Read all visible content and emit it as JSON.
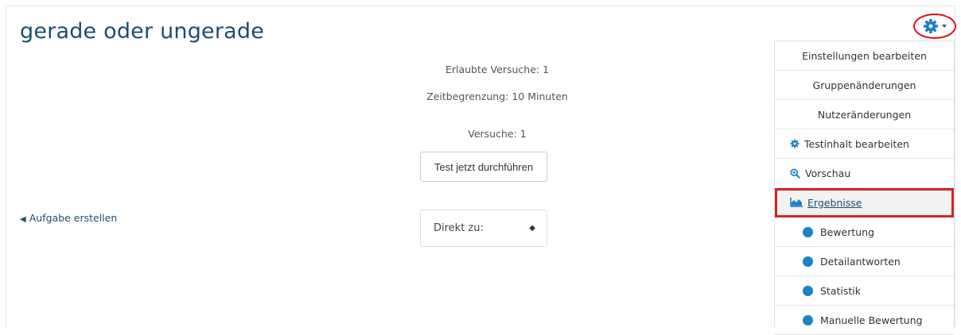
{
  "page": {
    "title": "gerade oder ungerade",
    "attempts_allowed": "Erlaubte Versuche: 1",
    "time_limit": "Zeitbegrenzung: 10 Minuten",
    "attempts": "Versuche: 1",
    "attempt_button": "Test jetzt durchführen",
    "jump_label": "Direkt zu:",
    "prev_link": "Aufgabe erstellen"
  },
  "menu": {
    "items": [
      {
        "label": "Einstellungen bearbeiten"
      },
      {
        "label": "Gruppenänderungen"
      },
      {
        "label": "Nutzeränderungen"
      },
      {
        "label": "Testinhalt bearbeiten",
        "icon": "gear-icon"
      },
      {
        "label": "Vorschau",
        "icon": "magnifier-plus-icon"
      },
      {
        "label": "Ergebnisse",
        "icon": "area-chart-icon"
      },
      {
        "label": "Bewertung",
        "icon": "circle-icon"
      },
      {
        "label": "Detailantworten",
        "icon": "circle-icon"
      },
      {
        "label": "Statistik",
        "icon": "circle-icon"
      },
      {
        "label": "Manuelle Bewertung",
        "icon": "circle-icon"
      }
    ]
  },
  "colors": {
    "accent": "#1d81c6",
    "title": "#1b4f6f",
    "highlight_border": "#d8232a"
  }
}
